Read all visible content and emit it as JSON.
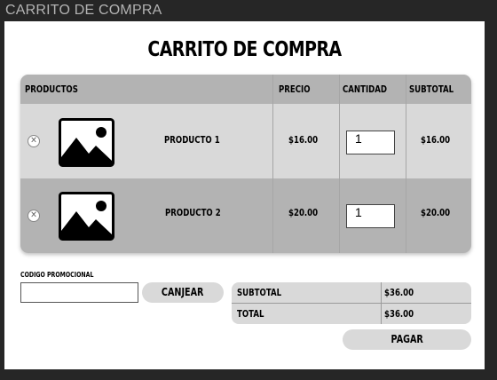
{
  "window": {
    "title": "CARRITO DE COMPRA"
  },
  "page": {
    "heading": "CARRITO DE COMPRA"
  },
  "table": {
    "headers": {
      "products": "PRODUCTOS",
      "price": "PRECIO",
      "quantity": "CANTIDAD",
      "subtotal": "SUBTOTAL"
    },
    "rows": [
      {
        "remove_icon": "close-icon",
        "image_icon": "image-placeholder-icon",
        "name": "PRODUCTO 1",
        "price": "$16.00",
        "quantity": "1",
        "subtotal": "$16.00"
      },
      {
        "remove_icon": "close-icon",
        "image_icon": "image-placeholder-icon",
        "name": "PRODUCTO 2",
        "price": "$20.00",
        "quantity": "1",
        "subtotal": "$20.00"
      }
    ]
  },
  "promo": {
    "label": "CODIGO PROMOCIONAL",
    "value": "",
    "redeem_label": "CANJEAR"
  },
  "summary": {
    "subtotal_label": "SUBTOTAL",
    "subtotal_value": "$36.00",
    "total_label": "TOTAL",
    "total_value": "$36.00"
  },
  "checkout": {
    "pay_label": "PAGAR"
  },
  "colors": {
    "background": "#262626",
    "header_row": "#b3b3b3",
    "row_light": "#d9d9d9",
    "row_dark": "#b3b3b3",
    "button": "#d9d9d9"
  }
}
